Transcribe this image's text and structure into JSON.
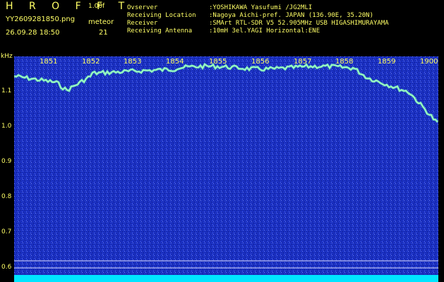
{
  "header": {
    "brand": "H R O F F T",
    "version": "1.00f",
    "filename": "YY2609281850.png",
    "meteor_label": "meteor",
    "datetime": "26.09.28 18:50",
    "meteor_count": "21"
  },
  "info": [
    {
      "key": "Ovserver",
      "value": ":YOSHIKAWA Yasufumi /JG2MLI"
    },
    {
      "key": "Receiving Location",
      "value": ":Nagoya Aichi-pref. JAPAN (136.90E, 35.20N)"
    },
    {
      "key": "Receiver",
      "value": ":SMArt RTL-SDR V5 52.905MHz USB HIGASHIMURAYAMA"
    },
    {
      "key": "Receiving Antenna",
      "value": ":10mH 3el.YAGI Horizontal:ENE"
    }
  ],
  "axis": {
    "unit": "kHz",
    "y_ticks": [
      "1.1",
      "1.0",
      "0.9",
      "0.8",
      "0.7",
      "0.6"
    ],
    "x_ticks": [
      "1851",
      "1852",
      "1853",
      "1854",
      "1855",
      "1856",
      "1857",
      "1858",
      "1859",
      "1900"
    ]
  },
  "colors": {
    "background": "#000000",
    "text": "#ffff66",
    "spectrum": "#1a2fbf",
    "signal": "#7fffb0",
    "floor": "#00e5ff"
  }
}
